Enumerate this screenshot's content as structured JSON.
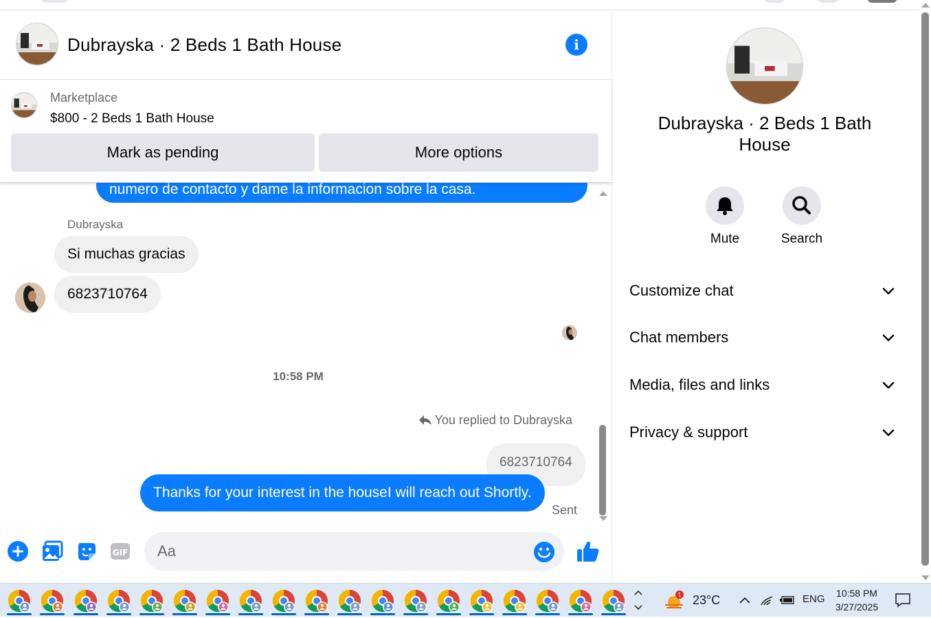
{
  "header": {
    "title": "Dubrayska · 2 Beds 1 Bath House",
    "info_icon": "i"
  },
  "marketplace": {
    "label": "Marketplace",
    "listing": "$800 - 2 Beds 1 Bath House",
    "mark_pending_label": "Mark as pending",
    "more_options_label": "More options"
  },
  "messages": {
    "partial_outgoing": "numero de contacto y dame la informacion sobre la casa.",
    "sender_name": "Dubrayska",
    "incoming_1": "Si muchas gracias",
    "incoming_2": "6823710764",
    "timestamp": "10:58 PM",
    "replied_label": "You replied to Dubrayska",
    "quoted_text": "6823710764",
    "outgoing_reply": "Thanks for your interest in the houseI will reach out Shortly.",
    "sent_label": "Sent"
  },
  "composer": {
    "placeholder": "Aa"
  },
  "sidebar": {
    "name": "Dubrayska · 2 Beds 1 Bath House",
    "mute_label": "Mute",
    "search_label": "Search",
    "sections": [
      {
        "label": "Customize chat"
      },
      {
        "label": "Chat members"
      },
      {
        "label": "Media, files and links"
      },
      {
        "label": "Privacy & support"
      }
    ]
  },
  "taskbar": {
    "weather_badge": "1",
    "temperature": "23°C",
    "language": "ENG",
    "time": "10:58 PM",
    "date": "3/27/2025"
  },
  "colors": {
    "messenger_blue": "#0a7cff",
    "bubble_grey": "#f0f0f0",
    "button_grey": "#e4e6eb",
    "secondary_text": "#65676b"
  }
}
